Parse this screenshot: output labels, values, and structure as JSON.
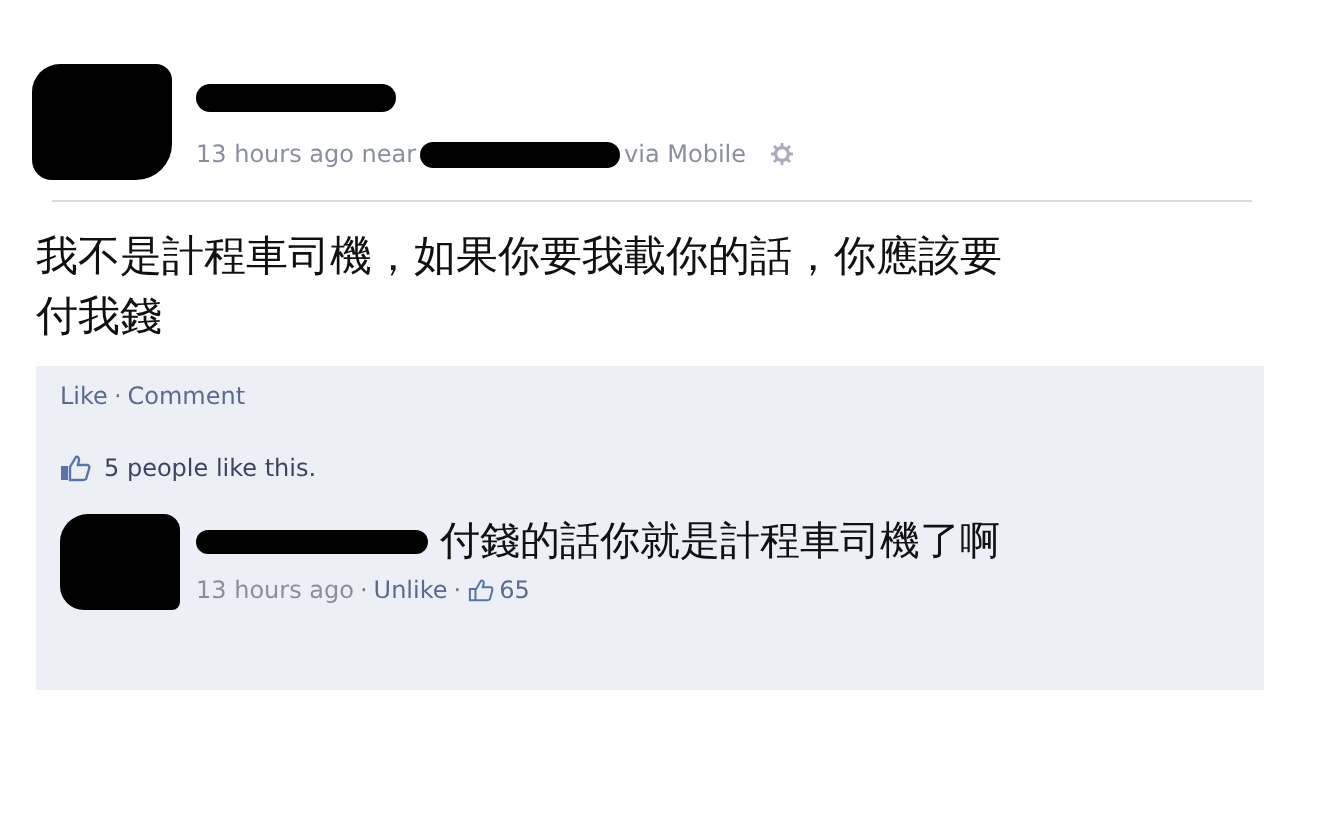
{
  "post": {
    "meta_before": "13 hours ago near",
    "meta_after": "via Mobile",
    "text": "我不是計程車司機，如果你要我載你的話，你應該要付我錢"
  },
  "separator": "·",
  "actions": [
    {
      "label": "Like"
    },
    {
      "label": "Comment"
    }
  ],
  "likes": {
    "text": "5 people like this."
  },
  "comment": {
    "text": "付錢的話你就是計程車司機了啊",
    "time": "13 hours ago",
    "action": "Unlike",
    "like_count": "65"
  }
}
